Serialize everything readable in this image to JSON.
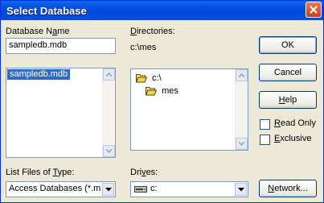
{
  "dialog": {
    "title": "Select Database"
  },
  "database_name": {
    "label_pre": "Database N",
    "label_u": "a",
    "label_post": "me",
    "value": "sampledb.mdb",
    "files": [
      "sampledb.mdb"
    ]
  },
  "directories": {
    "label_pre": "",
    "label_u": "D",
    "label_post": "irectories:",
    "current": "c:\\mes",
    "items": [
      {
        "name": "c:\\",
        "icon": "open-folder-icon"
      },
      {
        "name": "mes",
        "icon": "open-folder-icon"
      }
    ]
  },
  "file_type": {
    "label_pre": "List Files of ",
    "label_u": "T",
    "label_post": "ype:",
    "value": "Access Databases (*.m"
  },
  "drives": {
    "label_pre": "Dri",
    "label_u": "v",
    "label_post": "es:",
    "value": "c:",
    "icon": "drive-icon"
  },
  "buttons": {
    "ok": "OK",
    "cancel": "Cancel",
    "help_pre": "",
    "help_u": "H",
    "help_post": "elp",
    "network_pre": "",
    "network_u": "N",
    "network_post": "etwork..."
  },
  "checkboxes": {
    "read_only_pre": "",
    "read_only_u": "R",
    "read_only_post": "ead Only",
    "read_only_checked": false,
    "exclusive_pre": "",
    "exclusive_u": "E",
    "exclusive_post": "xclusive",
    "exclusive_checked": false
  },
  "colors": {
    "titlebar": "#0451e0",
    "selection": "#316ac5",
    "dialog_bg": "#ece9d8"
  }
}
